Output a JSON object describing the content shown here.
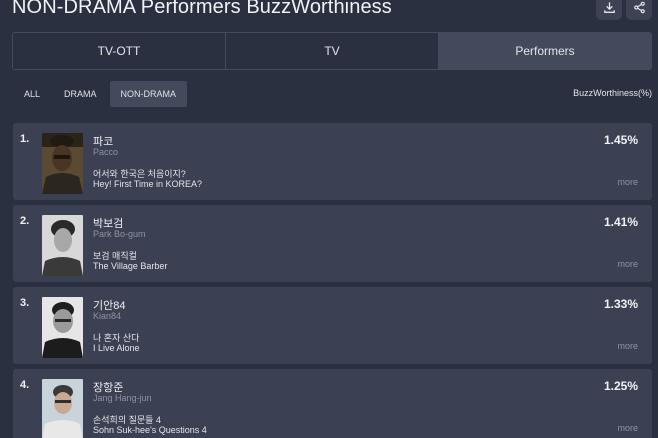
{
  "header": {
    "title": "NON-DRAMA Performers BuzzWorthiness",
    "download_icon": "download-icon",
    "share_icon": "share-icon"
  },
  "tabs": [
    {
      "label": "TV-OTT",
      "active": false
    },
    {
      "label": "TV",
      "active": false
    },
    {
      "label": "Performers",
      "active": true
    }
  ],
  "filters": [
    {
      "label": "ALL",
      "active": false
    },
    {
      "label": "DRAMA",
      "active": false
    },
    {
      "label": "NON-DRAMA",
      "active": true
    }
  ],
  "metric_label": "BuzzWorthiness(%)",
  "colors": {
    "background": "#2b3040",
    "card": "#3b4152",
    "active_tab": "#434a5c"
  },
  "rankings": [
    {
      "rank": "1.",
      "name": "파코",
      "name_en": "Pacco",
      "show_ko": "어서와 한국은 처음이지?",
      "show_en": "Hey! First Time in KOREA?",
      "percent": "1.45%",
      "more": "more"
    },
    {
      "rank": "2.",
      "name": "박보검",
      "name_en": "Park Bo-gum",
      "show_ko": "보검 매직컬",
      "show_en": "The Village Barber",
      "percent": "1.41%",
      "more": "more"
    },
    {
      "rank": "3.",
      "name": "기안84",
      "name_en": "Kian84",
      "show_ko": "나 혼자 산다",
      "show_en": "I Live Alone",
      "percent": "1.33%",
      "more": "more"
    },
    {
      "rank": "4.",
      "name": "장항준",
      "name_en": "Jang Hang-jun",
      "show_ko": "손석희의 질문들 4",
      "show_en": "Sohn Suk-hee's Questions 4",
      "percent": "1.25%",
      "more": "more"
    }
  ]
}
